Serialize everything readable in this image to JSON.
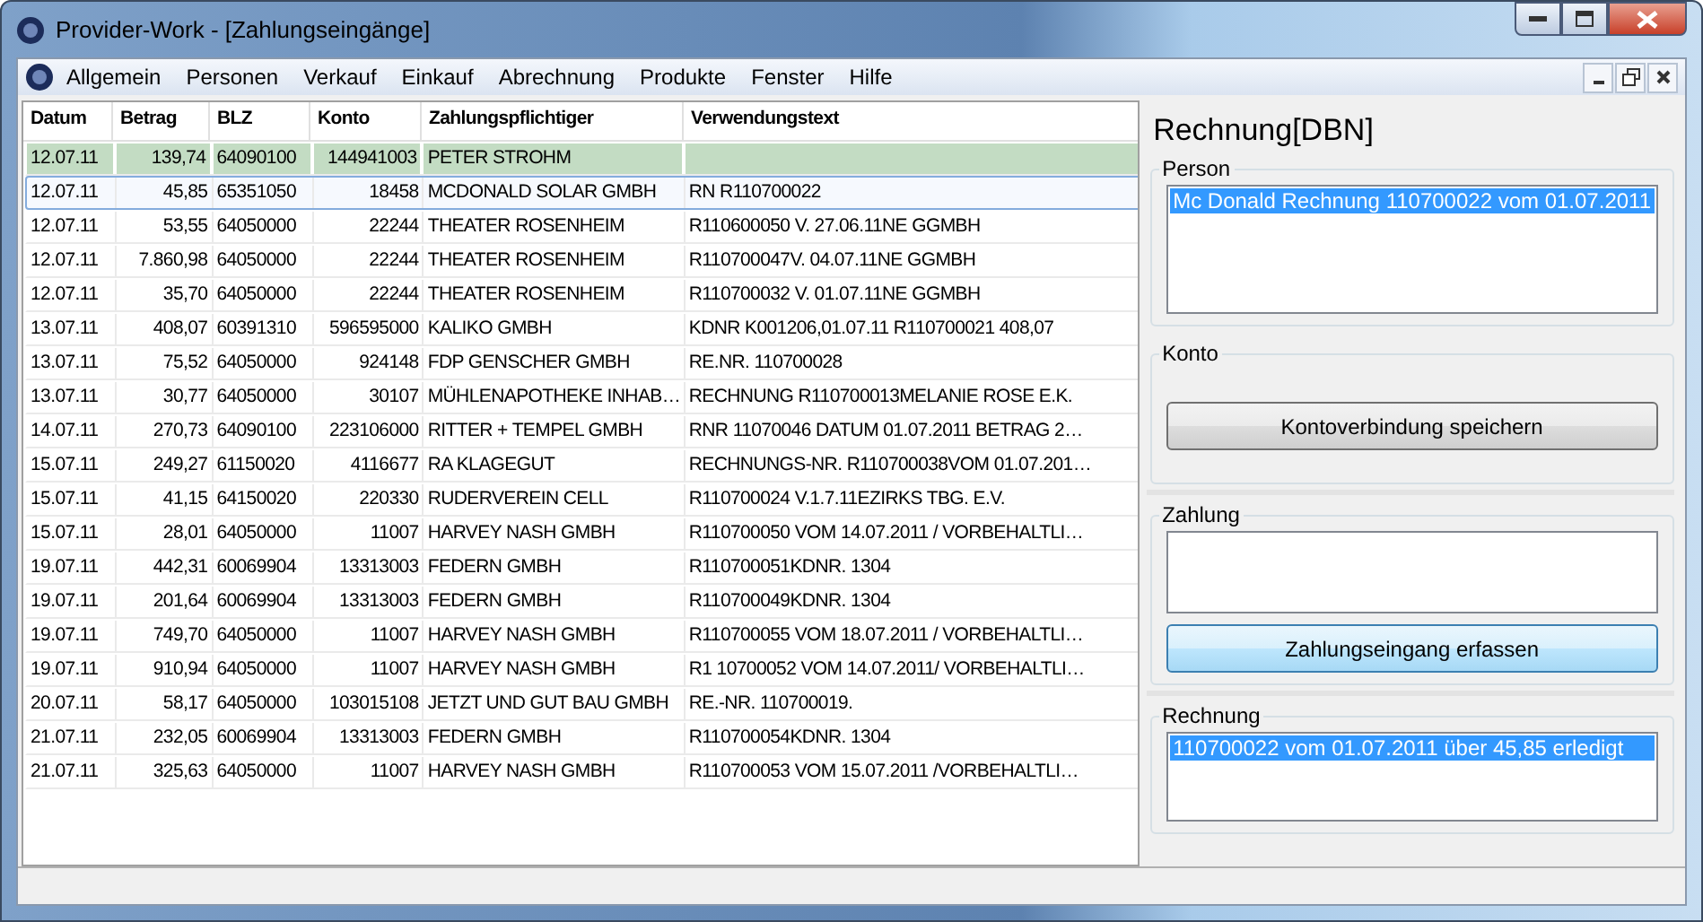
{
  "window": {
    "title": "Provider-Work - [Zahlungseingänge]"
  },
  "menu": [
    "Allgemein",
    "Personen",
    "Verkauf",
    "Einkauf",
    "Abrechnung",
    "Produkte",
    "Fenster",
    "Hilfe"
  ],
  "table": {
    "columns": [
      "Datum",
      "Betrag",
      "BLZ",
      "Konto",
      "Zahlungspflichtiger",
      "Verwendungstext"
    ],
    "rows": [
      {
        "cells": [
          "12.07.11",
          "139,74",
          "64090100",
          "144941003",
          "PETER STROHM",
          ""
        ],
        "highlighted": true,
        "selected": false
      },
      {
        "cells": [
          "12.07.11",
          "45,85",
          "65351050",
          "18458",
          "MCDONALD SOLAR GMBH",
          "RN R110700022"
        ],
        "highlighted": false,
        "selected": true
      },
      {
        "cells": [
          "12.07.11",
          "53,55",
          "64050000",
          "22244",
          "THEATER ROSENHEIM",
          "R110600050 V. 27.06.11NE GGMBH"
        ],
        "highlighted": false,
        "selected": false
      },
      {
        "cells": [
          "12.07.11",
          "7.860,98",
          "64050000",
          "22244",
          "THEATER ROSENHEIM",
          "R110700047V. 04.07.11NE GGMBH"
        ],
        "highlighted": false,
        "selected": false
      },
      {
        "cells": [
          "12.07.11",
          "35,70",
          "64050000",
          "22244",
          "THEATER ROSENHEIM",
          "R110700032 V. 01.07.11NE GGMBH"
        ],
        "highlighted": false,
        "selected": false
      },
      {
        "cells": [
          "13.07.11",
          "408,07",
          "60391310",
          "596595000",
          "KALIKO GMBH",
          "KDNR K001206,01.07.11  R110700021   408,07"
        ],
        "highlighted": false,
        "selected": false
      },
      {
        "cells": [
          "13.07.11",
          "75,52",
          "64050000",
          "924148",
          "FDP GENSCHER GMBH",
          "RE.NR. 110700028"
        ],
        "highlighted": false,
        "selected": false
      },
      {
        "cells": [
          "13.07.11",
          "30,77",
          "64050000",
          "30107",
          "MÜHLENAPOTHEKE INHAB…",
          "RECHNUNG R110700013MELANIE ROSE E.K."
        ],
        "highlighted": false,
        "selected": false
      },
      {
        "cells": [
          "14.07.11",
          "270,73",
          "64090100",
          "223106000",
          "RITTER + TEMPEL GMBH",
          "RNR 11070046 DATUM 01.07.2011 BETRAG 2…"
        ],
        "highlighted": false,
        "selected": false
      },
      {
        "cells": [
          "15.07.11",
          "249,27",
          "61150020",
          "4116677",
          "RA KLAGEGUT",
          "RECHNUNGS-NR. R110700038VOM 01.07.201…"
        ],
        "highlighted": false,
        "selected": false
      },
      {
        "cells": [
          "15.07.11",
          "41,15",
          "64150020",
          "220330",
          "RUDERVEREIN CELL",
          "R110700024 V.1.7.11EZIRKS TBG. E.V."
        ],
        "highlighted": false,
        "selected": false
      },
      {
        "cells": [
          "15.07.11",
          "28,01",
          "64050000",
          "11007",
          "HARVEY NASH GMBH",
          "R110700050 VOM 14.07.2011 / VORBEHALTLI…"
        ],
        "highlighted": false,
        "selected": false
      },
      {
        "cells": [
          "19.07.11",
          "442,31",
          "60069904",
          "13313003",
          "FEDERN GMBH",
          "R110700051KDNR. 1304"
        ],
        "highlighted": false,
        "selected": false
      },
      {
        "cells": [
          "19.07.11",
          "201,64",
          "60069904",
          "13313003",
          "FEDERN GMBH",
          "R110700049KDNR. 1304"
        ],
        "highlighted": false,
        "selected": false
      },
      {
        "cells": [
          "19.07.11",
          "749,70",
          "64050000",
          "11007",
          "HARVEY NASH GMBH",
          "R110700055 VOM 18.07.2011 / VORBEHALTLI…"
        ],
        "highlighted": false,
        "selected": false
      },
      {
        "cells": [
          "19.07.11",
          "910,94",
          "64050000",
          "11007",
          "HARVEY NASH GMBH",
          "R1 10700052 VOM 14.07.2011/ VORBEHALTLI…"
        ],
        "highlighted": false,
        "selected": false
      },
      {
        "cells": [
          "20.07.11",
          "58,17",
          "64050000",
          "103015108",
          "JETZT UND GUT BAU GMBH",
          "RE.-NR. 110700019."
        ],
        "highlighted": false,
        "selected": false
      },
      {
        "cells": [
          "21.07.11",
          "232,05",
          "60069904",
          "13313003",
          "FEDERN GMBH",
          "R110700054KDNR. 1304"
        ],
        "highlighted": false,
        "selected": false
      },
      {
        "cells": [
          "21.07.11",
          "325,63",
          "64050000",
          "11007",
          "HARVEY NASH GMBH",
          "R110700053 VOM 15.07.2011 /VORBEHALTLI…"
        ],
        "highlighted": false,
        "selected": false
      }
    ]
  },
  "panel": {
    "title": "Rechnung[DBN]",
    "groups": [
      {
        "kind": "list",
        "label": "Person",
        "items": [
          {
            "text": "Mc Donald Rechnung 110700022 vom 01.07.2011",
            "selected": true
          }
        ]
      },
      {
        "kind": "button",
        "label": "Konto",
        "button": {
          "label": "Kontoverbindung speichern",
          "default": false
        }
      },
      {
        "kind": "list_button",
        "label": "Zahlung",
        "button": {
          "label": "Zahlungseingang erfassen",
          "default": true
        }
      },
      {
        "kind": "list",
        "label": "Rechnung",
        "items": [
          {
            "text": "110700022 vom 01.07.2011 über 45,85 erledigt",
            "selected": true
          }
        ]
      }
    ]
  }
}
